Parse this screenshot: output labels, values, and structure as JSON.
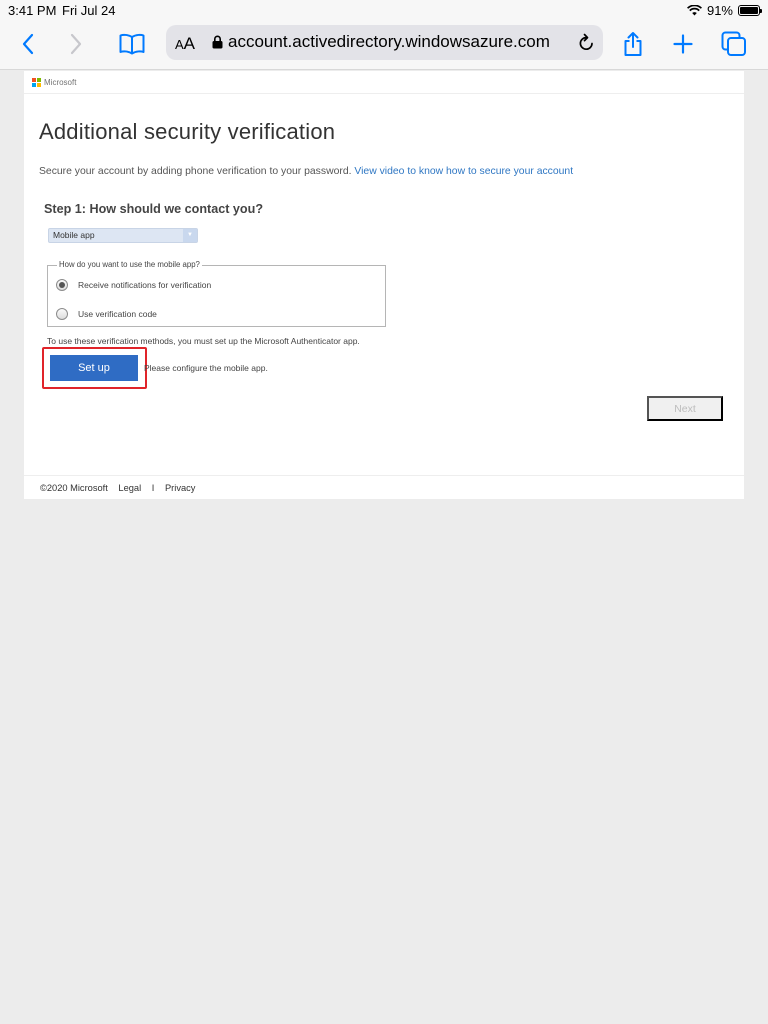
{
  "status_bar": {
    "time": "3:41 PM",
    "date": "Fri Jul 24",
    "battery": "91%",
    "battery_level": 0.91
  },
  "browser": {
    "text_size_label_small": "A",
    "text_size_label_large": "A",
    "url": "account.activedirectory.windowsazure.com",
    "accent_color": "#007aff",
    "icons": [
      "back-icon",
      "forward-icon",
      "bookmarks-icon",
      "lock-icon",
      "reload-icon",
      "share-icon",
      "new-tab-icon",
      "tabs-icon"
    ]
  },
  "page": {
    "brand": "Microsoft",
    "title": "Additional security verification",
    "intro_text": "Secure your account by adding phone verification to your password.",
    "intro_link": "View video to know how to secure your account",
    "step_heading": "Step 1: How should we contact you?",
    "contact_method": {
      "selected": "Mobile app"
    },
    "mobile_app_group": {
      "legend": "How do you want to use the mobile app?",
      "options": [
        {
          "label": "Receive notifications for verification",
          "selected": true
        },
        {
          "label": "Use verification code",
          "selected": false
        }
      ]
    },
    "authenticator_note": "To use these verification methods, you must set up the Microsoft Authenticator app.",
    "setup_button": "Set up",
    "setup_status": "Please configure the mobile app.",
    "next_button": "Next",
    "highlight_color": "#e0242a",
    "primary_button_color": "#2f6cc4",
    "link_color": "#2f77c3"
  },
  "footer": {
    "copyright": "©2020 Microsoft",
    "legal": "Legal",
    "separator": "I",
    "privacy": "Privacy"
  }
}
